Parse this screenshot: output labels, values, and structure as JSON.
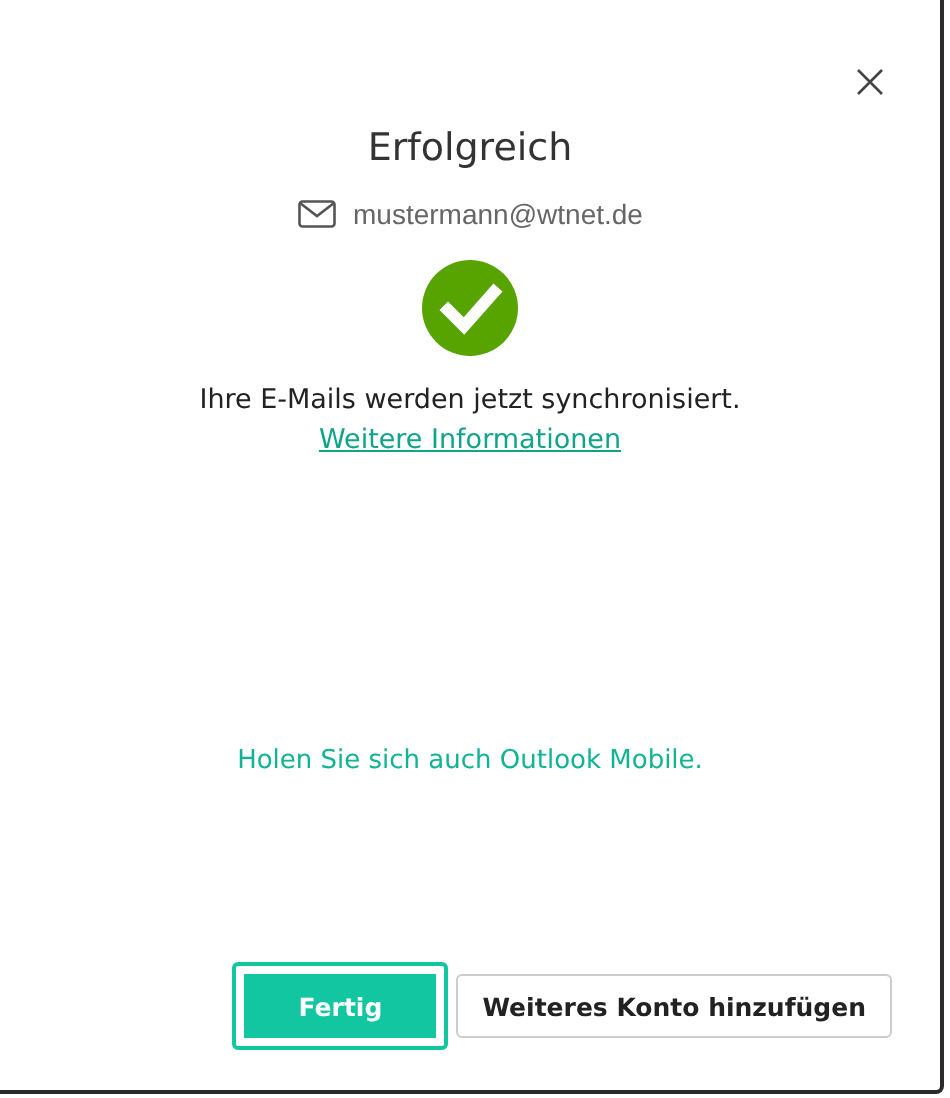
{
  "dialog": {
    "title": "Erfolgreich",
    "account_email": "mustermann@wtnet.de",
    "message": "Ihre E-Mails werden jetzt synchronisiert.",
    "info_link": "Weitere Informationen",
    "mobile_link": "Holen Sie sich auch Outlook Mobile.",
    "buttons": [
      {
        "label": "Fertig",
        "kind": "primary",
        "focused": true
      },
      {
        "label": "Weiteres Konto hinzufügen",
        "kind": "secondary",
        "focused": false
      }
    ]
  }
}
